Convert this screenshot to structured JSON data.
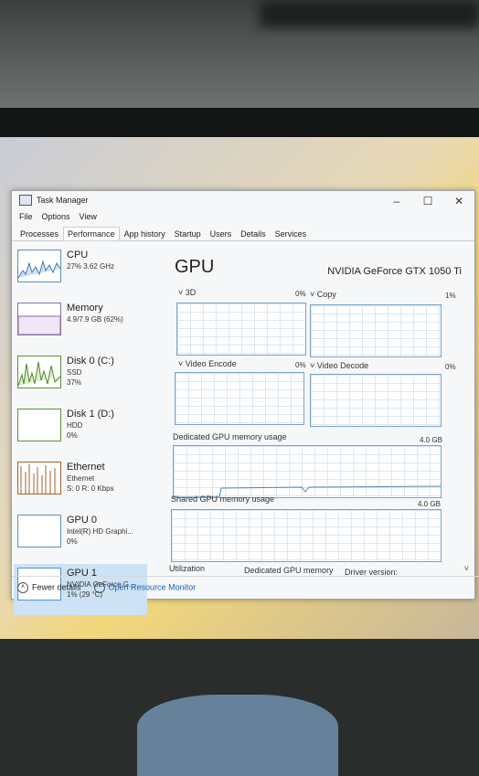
{
  "window": {
    "title": "Task Manager",
    "controls": [
      "–",
      "☐",
      "✕"
    ]
  },
  "menu": [
    "File",
    "Options",
    "View"
  ],
  "tabs": [
    "Processes",
    "Performance",
    "App history",
    "Startup",
    "Users",
    "Details",
    "Services"
  ],
  "active_tab": "Performance",
  "sidebar": [
    {
      "name": "CPU",
      "line1": "27% 3.62 GHz",
      "line2": ""
    },
    {
      "name": "Memory",
      "line1": "4.9/7.9 GB (62%)",
      "line2": ""
    },
    {
      "name": "Disk 0 (C:)",
      "line1": "SSD",
      "line2": "37%"
    },
    {
      "name": "Disk 1 (D:)",
      "line1": "HDD",
      "line2": "0%"
    },
    {
      "name": "Ethernet",
      "line1": "Ethernet",
      "line2": "S: 0 R: 0 Kbps"
    },
    {
      "name": "GPU 0",
      "line1": "Intel(R) HD Graphi...",
      "line2": "0%"
    },
    {
      "name": "GPU 1",
      "line1": "NVIDIA GeForce G...",
      "line2": "1% (29 °C)"
    }
  ],
  "selected_item": "GPU 1",
  "main": {
    "title": "GPU",
    "device": "NVIDIA GeForce GTX 1050 Ti",
    "engines": [
      {
        "label": "3D",
        "pct": "0%"
      },
      {
        "label": "Copy",
        "pct": "1%"
      },
      {
        "label": "Video Encode",
        "pct": "0%"
      },
      {
        "label": "Video Decode",
        "pct": "0%"
      }
    ],
    "dedicated_label": "Dedicated GPU memory usage",
    "dedicated_max": "4.0 GB",
    "shared_label": "Shared GPU memory usage",
    "shared_max": "4.0 GB",
    "stats_headers": [
      "Utilization",
      "Dedicated GPU memory",
      "Driver version:"
    ]
  },
  "bottom": {
    "fewer": "Fewer details",
    "monitor": "Open Resource Monitor"
  }
}
